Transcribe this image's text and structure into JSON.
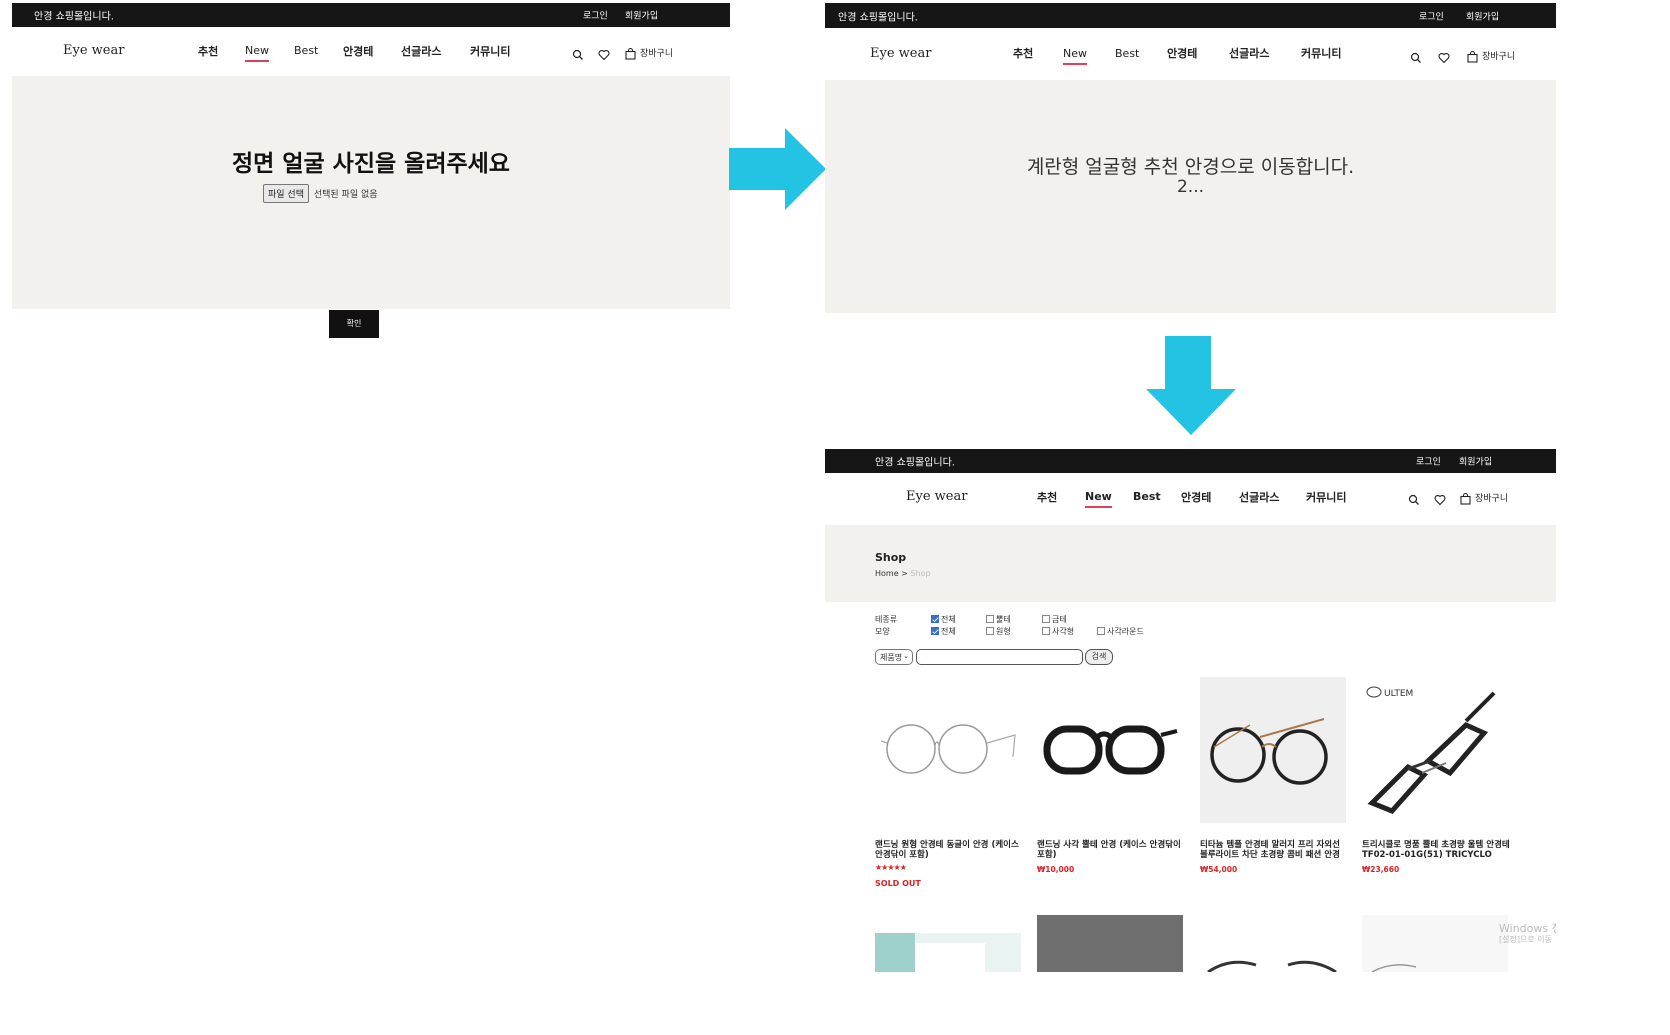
{
  "header": {
    "notice": "안경 쇼핑몰입니다.",
    "login": "로그인",
    "signup": "회원가입",
    "brand": "Eye wear",
    "nav": [
      "추천",
      "New",
      "Best",
      "안경테",
      "선글라스",
      "커뮤니티"
    ],
    "active_nav": "New",
    "cart_label": "장바구니",
    "icons": [
      "search-icon",
      "heart-icon",
      "bag-icon"
    ]
  },
  "screen1": {
    "heading": "정면 얼굴 사진을 올려주세요",
    "file_button": "파일 선택",
    "file_status": "선택된 파일 없음",
    "confirm_button": "확인"
  },
  "screen2": {
    "message_line1": "계란형 얼굴형 추천 안경으로 이동합니다.",
    "message_line2": "2..."
  },
  "screen3": {
    "title": "Shop",
    "breadcrumb_home": "Home",
    "breadcrumb_separator": ">",
    "breadcrumb_current": "Shop",
    "filters": {
      "type_label": "테종류",
      "type_options": [
        {
          "label": "전체",
          "checked": true
        },
        {
          "label": "뿔테",
          "checked": false
        },
        {
          "label": "금테",
          "checked": false
        }
      ],
      "shape_label": "모양",
      "shape_options": [
        {
          "label": "전체",
          "checked": true
        },
        {
          "label": "원형",
          "checked": false
        },
        {
          "label": "사각형",
          "checked": false
        },
        {
          "label": "사각라운드",
          "checked": false
        }
      ]
    },
    "search": {
      "select_value": "제품명",
      "button": "검색"
    },
    "products": [
      {
        "name": "랜드닝 원형 안경테 동글이 안경 (케이스 안경닦이 포함)",
        "stars": "★★★★★",
        "status": "SOLD OUT",
        "price": ""
      },
      {
        "name": "랜드닝 사각 뿔테 안경 (케이스 안경닦이 포함)",
        "price": "₩10,000"
      },
      {
        "name": "티타늄 템플 안경테 알러지 프리 자외선 블루라이트 차단 초경량 콤비 패션 안경",
        "price": "₩54,000"
      },
      {
        "name": "트리시클로 명품 뿔테 초경량 울템 안경테 TF02-01-01G(51) TRICYCLO",
        "price": "₩23,660"
      }
    ],
    "brand_logo_text": "ULTEM",
    "watermark_line1": "Windows 정",
    "watermark_line2": "[설정]으로 이동"
  },
  "colors": {
    "topbar": "#161616",
    "hero_bg": "#f2f1ee",
    "arrow": "#22c3e3",
    "active_underline": "#e0405a",
    "price": "#dd2222"
  }
}
